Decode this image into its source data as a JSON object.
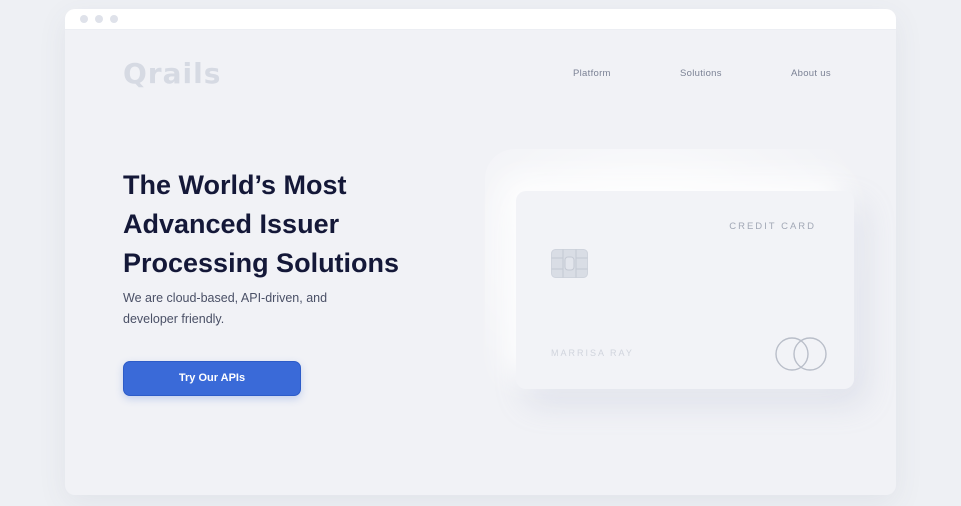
{
  "window": {
    "controls": [
      "close",
      "minimize",
      "maximize"
    ]
  },
  "header": {
    "logo": "Qrails",
    "nav": [
      "Platform",
      "Solutions",
      "About us"
    ]
  },
  "hero": {
    "headline": "The World’s Most Advanced Issuer Processing Solutions",
    "subtext": "We are cloud-based, API-driven, and developer friendly.",
    "cta_label": "Try Our APIs"
  },
  "card": {
    "label": "CREDIT CARD",
    "holder": "MARRISA RAY",
    "network_icon": "mastercard-icon",
    "chip_icon": "chip-icon"
  },
  "colors": {
    "accent": "#3a6ad8",
    "headline": "#141838",
    "background": "#f1f2f6"
  }
}
